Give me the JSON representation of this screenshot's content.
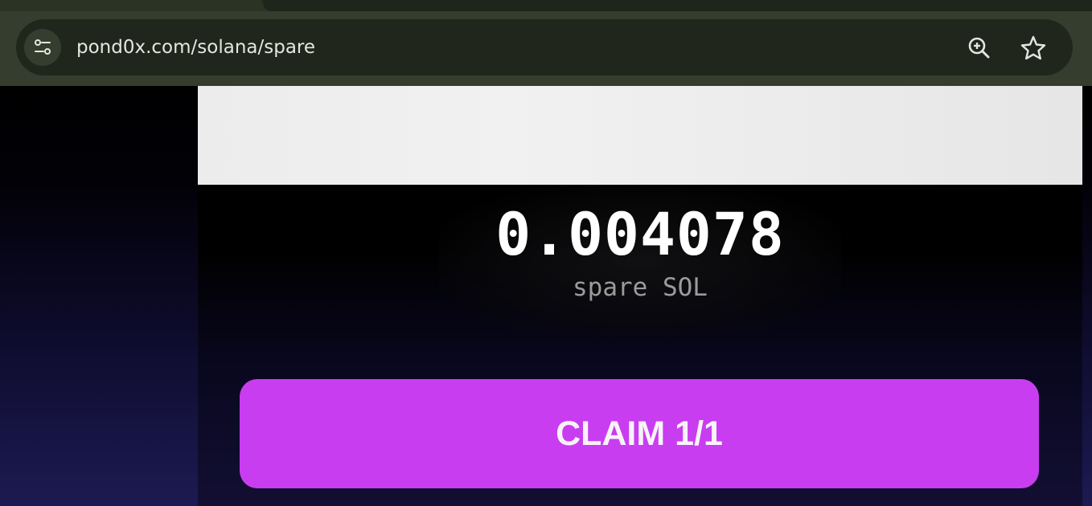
{
  "browser": {
    "url": "pond0x.com/solana/spare",
    "icons": {
      "site_info": "tune-icon",
      "zoom": "zoom-in-icon",
      "bookmark": "star-icon"
    }
  },
  "spare": {
    "amount": "0.004078",
    "unit": "spare SOL"
  },
  "claim": {
    "label": "CLAIM 1/1"
  },
  "colors": {
    "claim_button": "#c93df0",
    "chrome": "#353d2e",
    "address_bar": "#20261c"
  }
}
